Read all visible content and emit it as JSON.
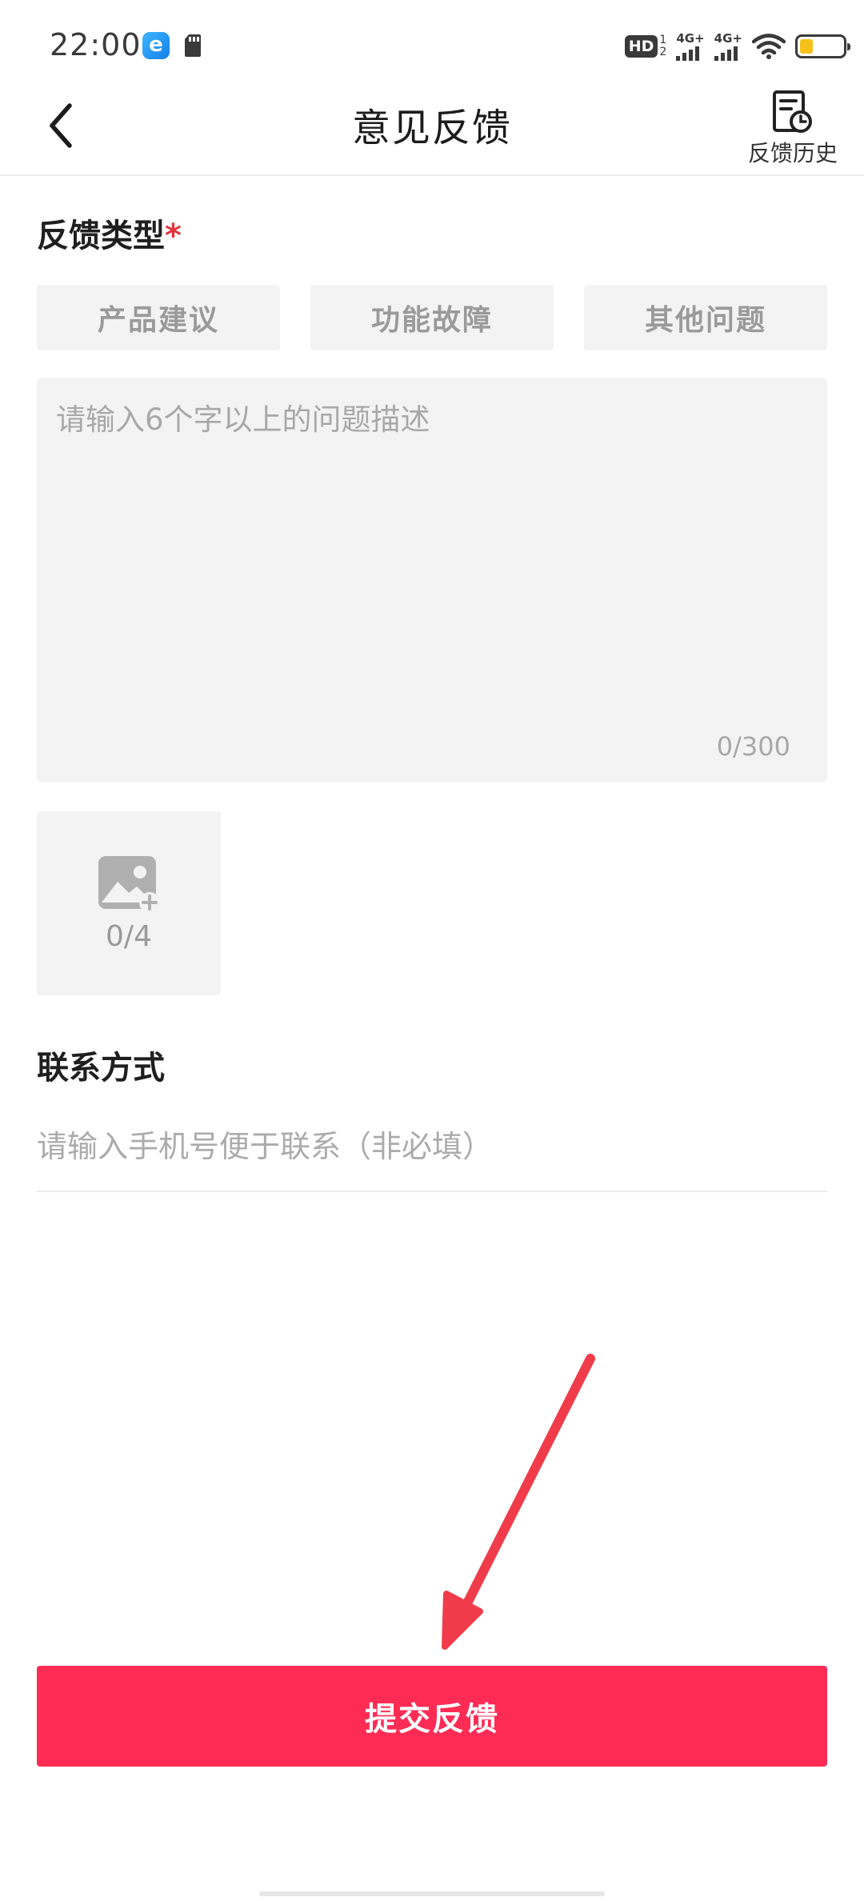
{
  "status_bar": {
    "time": "22:00",
    "app_icon_letter": "e",
    "hd_label": "HD",
    "hd_sup": "1",
    "hd_sub": "2",
    "signal_1_label": "4G+",
    "signal_2_label": "4G+",
    "battery_level": 0.3,
    "battery_color": "#f5c21b"
  },
  "nav": {
    "title": "意见反馈",
    "history_label": "反馈历史",
    "back_icon": "chevron-left-icon",
    "history_icon": "document-clock-icon"
  },
  "feedback_type": {
    "label": "反馈类型",
    "required_mark": "*",
    "options": [
      {
        "label": "产品建议"
      },
      {
        "label": "功能故障"
      },
      {
        "label": "其他问题"
      }
    ]
  },
  "description": {
    "placeholder": "请输入6个字以上的问题描述",
    "value": "",
    "counter": "0/300"
  },
  "image_upload": {
    "icon": "add-image-icon",
    "count": "0/4"
  },
  "contact": {
    "label": "联系方式",
    "placeholder": "请输入手机号便于联系（非必填）",
    "value": ""
  },
  "submit": {
    "label": "提交反馈"
  },
  "colors": {
    "accent": "#fe2c55",
    "arrow": "#f03c4a",
    "required": "#e0353b",
    "field_bg": "#f3f3f3"
  }
}
